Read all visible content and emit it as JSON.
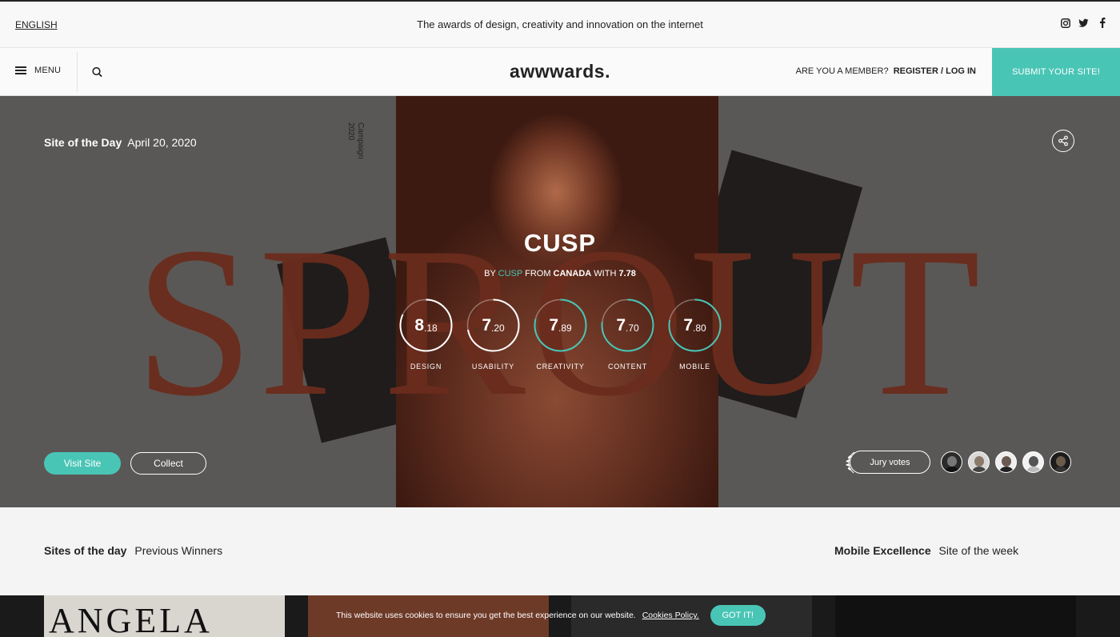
{
  "topbar": {
    "language": "ENGLISH",
    "tagline": "The awards of design, creativity and innovation on the internet",
    "socials": [
      "instagram-icon",
      "twitter-icon",
      "facebook-icon"
    ]
  },
  "nav": {
    "menu_label": "MENU",
    "logo": "awwwards.",
    "member_question": "ARE YOU A MEMBER?",
    "register_login": "REGISTER / LOG IN",
    "submit_label": "SUBMIT YOUR SITE!"
  },
  "hero": {
    "sotd_label": "Site of the Day",
    "date": "April 20, 2020",
    "background_word": "SPROUT",
    "campaign_text_line1": "Campaign",
    "campaign_text_line2": "2020",
    "site_name": "CUSP",
    "by_prefix": "BY",
    "author": "CUSP",
    "from_prefix": "FROM",
    "country": "CANADA",
    "with_prefix": "WITH",
    "overall_score": "7.78",
    "scores": [
      {
        "int": "8",
        "dec": ".18",
        "label": "DESIGN",
        "value": 8.18
      },
      {
        "int": "7",
        "dec": ".20",
        "label": "USABILITY",
        "value": 7.2
      },
      {
        "int": "7",
        "dec": ".89",
        "label": "CREATIVITY",
        "value": 7.89
      },
      {
        "int": "7",
        "dec": ".70",
        "label": "CONTENT",
        "value": 7.7
      },
      {
        "int": "7",
        "dec": ".80",
        "label": "MOBILE",
        "value": 7.8
      }
    ],
    "visit_label": "Visit Site",
    "collect_label": "Collect",
    "jury_label": "Jury votes"
  },
  "lists": {
    "left_title": "Sites of the day",
    "left_sub": "Previous Winners",
    "right_title": "Mobile Excellence",
    "right_sub": "Site of the week"
  },
  "thumbs": {
    "first_text": "ANGELA"
  },
  "cookie": {
    "text": "This website uses cookies to ensure you get the best experience on our website.",
    "link": "Cookies Policy.",
    "button": "GOT IT!"
  },
  "colors": {
    "accent": "#49c5b6",
    "hero_bg": "#5a5856",
    "word": "#6a2c1d"
  }
}
